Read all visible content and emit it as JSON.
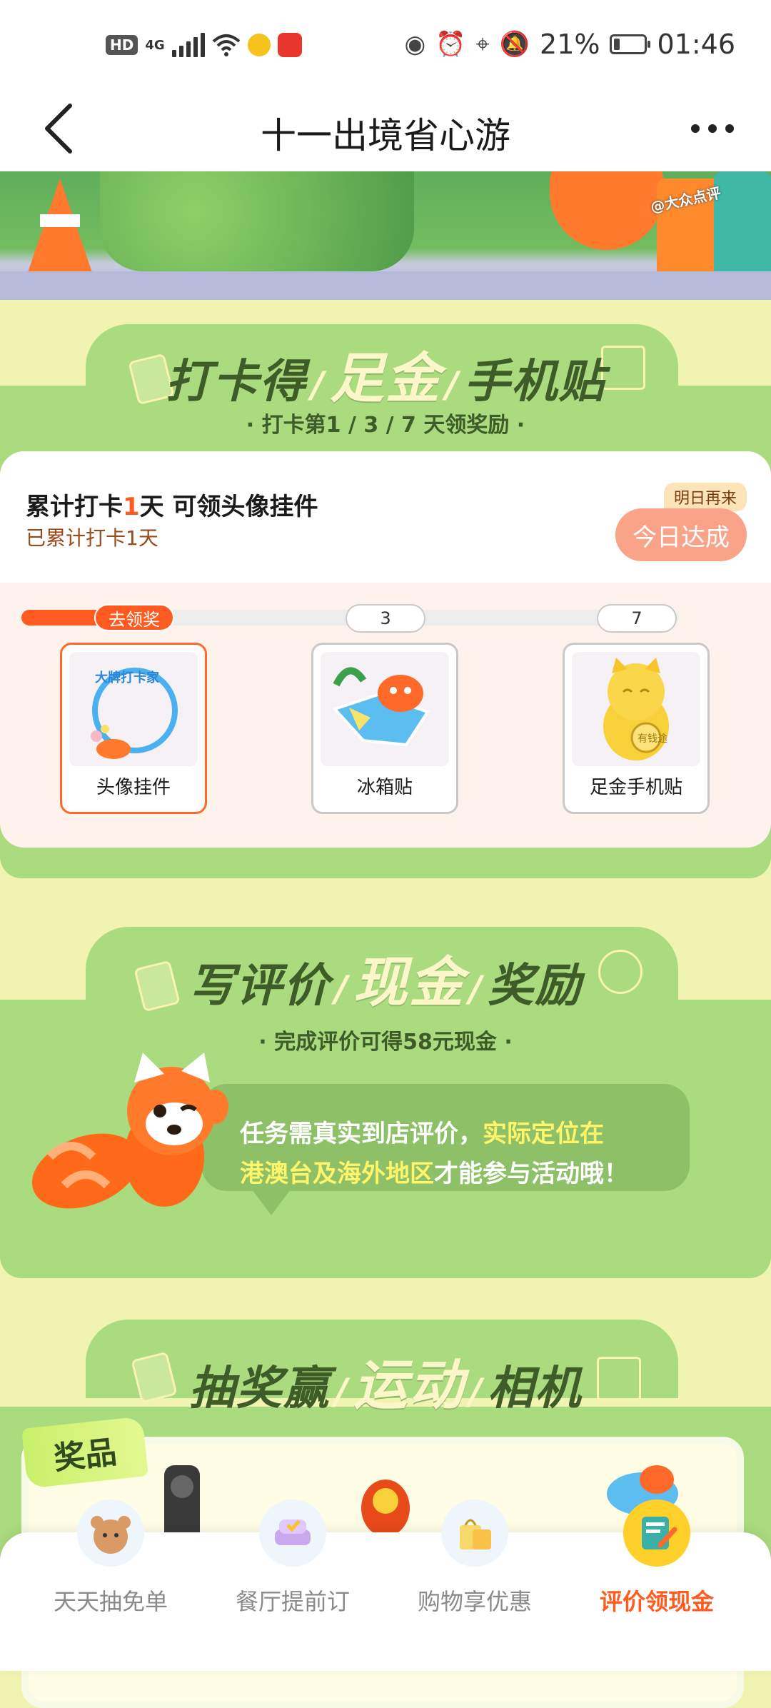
{
  "status_bar": {
    "left_badges": [
      "HD",
      "4G"
    ],
    "battery": "21%",
    "time": "01:46",
    "battery_level": 0.21,
    "icons": [
      "signal-icon",
      "wifi-icon",
      "eye-icon",
      "alarm-icon",
      "location-icon",
      "mute-icon",
      "battery-icon"
    ]
  },
  "header": {
    "title": "十一出境省心游"
  },
  "banner": {
    "stamp": "@大众点评"
  },
  "checkin_section": {
    "heading_part1": "打卡得",
    "heading_highlight": "足金",
    "heading_part2": "手机贴",
    "subtitle": "· 打卡第1 / 3 / 7 天领奖励 ·",
    "card": {
      "title_prefix": "累计打卡",
      "title_num": "1",
      "title_suffix": "天 可领头像挂件",
      "sub": "已累计打卡1天",
      "tag": "明日再来",
      "button": "今日达成"
    },
    "progress": {
      "fraction": 0.15,
      "claim_label": "去领奖",
      "milestones": [
        "3",
        "7"
      ]
    },
    "rewards": [
      {
        "label": "头像挂件",
        "active": true
      },
      {
        "label": "冰箱贴",
        "active": false
      },
      {
        "label": "足金手机贴",
        "active": false
      }
    ],
    "avatar_frame_text": "大牌打卡家",
    "lucky_cat_text": "有钱途"
  },
  "review_section": {
    "heading_part1": "写评价",
    "heading_highlight": "现金",
    "heading_part2": "奖励",
    "subtitle": "· 完成评价可得58元现金 ·",
    "notice_1": "任务需真实到店评价，",
    "notice_2_highlight": "实际定位在",
    "notice_3_highlight": "港澳台及海外地区",
    "notice_4": "才能参与活动哦！"
  },
  "lottery_section": {
    "heading_part1": "抽奖赢",
    "heading_highlight": "运动",
    "heading_part2": "相机",
    "prize_tag": "奖品"
  },
  "tabbar": {
    "tabs": [
      {
        "label": "天天抽免单",
        "icon": "bear-icon"
      },
      {
        "label": "餐厅提前订",
        "icon": "sofa-icon"
      },
      {
        "label": "购物享优惠",
        "icon": "shopping-bag-icon"
      },
      {
        "label": "评价领现金",
        "icon": "review-note-icon",
        "active": true
      }
    ]
  }
}
